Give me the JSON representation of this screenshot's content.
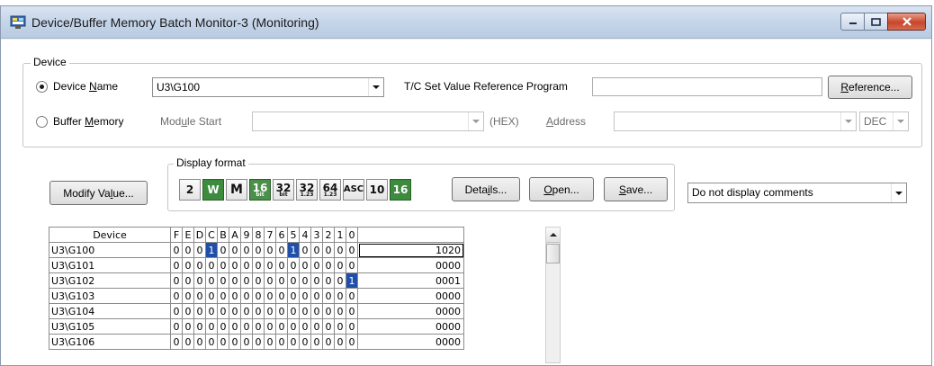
{
  "window": {
    "title": "Device/Buffer Memory Batch Monitor-3 (Monitoring)"
  },
  "device_group": {
    "title": "Device",
    "device_name_radio": "Device Name",
    "device_name_value": "U3\\G100",
    "tc_label": "T/C Set Value Reference Program",
    "reference_button": "Reference...",
    "buffer_memory_radio": "Buffer Memory",
    "module_start_label": "Module Start",
    "hex_label": "(HEX)",
    "address_label": "Address",
    "dec_value": "DEC"
  },
  "display_format": {
    "title": "Display format",
    "buttons": [
      "2",
      "W",
      "M",
      "16",
      "32",
      "32",
      "64",
      "ASC",
      "10",
      "16"
    ],
    "button_subs": [
      "",
      "",
      "",
      "bit",
      "bit",
      "1.23",
      "1.23",
      "",
      "",
      ""
    ],
    "details_button": "Details...",
    "open_button": "Open...",
    "save_button": "Save..."
  },
  "modify_value_button": "Modify Value...",
  "comment_select": "Do not display comments",
  "grid": {
    "header_device": "Device",
    "bit_headers": [
      "F",
      "E",
      "D",
      "C",
      "B",
      "A",
      "9",
      "8",
      "7",
      "6",
      "5",
      "4",
      "3",
      "2",
      "1",
      "0"
    ],
    "rows": [
      {
        "device": "U3\\G100",
        "bits": [
          "0",
          "0",
          "0",
          "1",
          "0",
          "0",
          "0",
          "0",
          "0",
          "0",
          "1",
          "0",
          "0",
          "0",
          "0",
          "0"
        ],
        "value": "1020"
      },
      {
        "device": "U3\\G101",
        "bits": [
          "0",
          "0",
          "0",
          "0",
          "0",
          "0",
          "0",
          "0",
          "0",
          "0",
          "0",
          "0",
          "0",
          "0",
          "0",
          "0"
        ],
        "value": "0000"
      },
      {
        "device": "U3\\G102",
        "bits": [
          "0",
          "0",
          "0",
          "0",
          "0",
          "0",
          "0",
          "0",
          "0",
          "0",
          "0",
          "0",
          "0",
          "0",
          "0",
          "1"
        ],
        "value": "0001"
      },
      {
        "device": "U3\\G103",
        "bits": [
          "0",
          "0",
          "0",
          "0",
          "0",
          "0",
          "0",
          "0",
          "0",
          "0",
          "0",
          "0",
          "0",
          "0",
          "0",
          "0"
        ],
        "value": "0000"
      },
      {
        "device": "U3\\G104",
        "bits": [
          "0",
          "0",
          "0",
          "0",
          "0",
          "0",
          "0",
          "0",
          "0",
          "0",
          "0",
          "0",
          "0",
          "0",
          "0",
          "0"
        ],
        "value": "0000"
      },
      {
        "device": "U3\\G105",
        "bits": [
          "0",
          "0",
          "0",
          "0",
          "0",
          "0",
          "0",
          "0",
          "0",
          "0",
          "0",
          "0",
          "0",
          "0",
          "0",
          "0"
        ],
        "value": "0000"
      },
      {
        "device": "U3\\G106",
        "bits": [
          "0",
          "0",
          "0",
          "0",
          "0",
          "0",
          "0",
          "0",
          "0",
          "0",
          "0",
          "0",
          "0",
          "0",
          "0",
          "0"
        ],
        "value": "0000"
      }
    ]
  },
  "colors": {
    "bit_on": "#1f4fa8",
    "green_button": "#3d8b3d"
  }
}
